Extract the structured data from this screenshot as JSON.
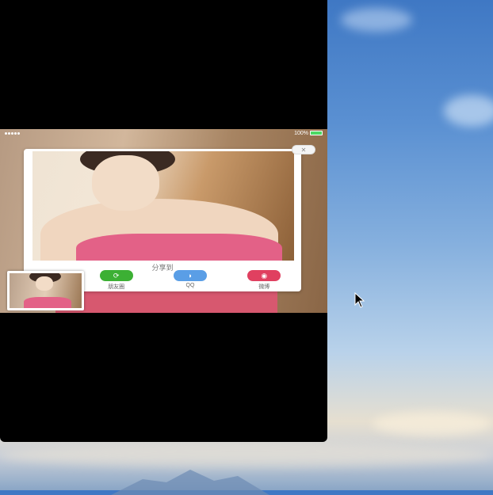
{
  "status_bar": {
    "battery_text": "100%",
    "battery_level": 1.0
  },
  "share_sheet": {
    "close_icon": "close-icon",
    "title": "分享到",
    "options": [
      {
        "label": "朋友圈",
        "icon": "wechat-moments-icon",
        "color": "#3cb034",
        "glyph": "⟳"
      },
      {
        "label": "QQ",
        "icon": "qq-icon",
        "color": "#5a9ee6",
        "glyph": "◗"
      },
      {
        "label": "微博",
        "icon": "weibo-icon",
        "color": "#e04060",
        "glyph": "◉"
      }
    ]
  },
  "colors": {
    "dress": "#e36187",
    "moments": "#3cb034",
    "qq": "#5a9ee6",
    "weibo": "#e04060"
  }
}
